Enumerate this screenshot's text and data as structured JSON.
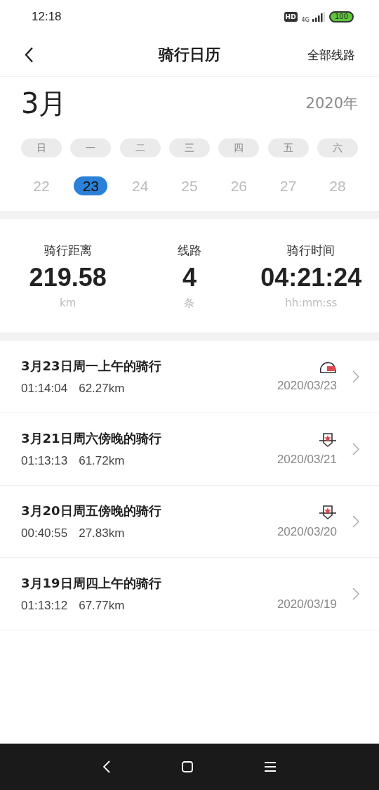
{
  "status_bar": {
    "time": "12:18",
    "hd": "HD",
    "network": "4G",
    "battery": "100"
  },
  "header": {
    "title": "骑行日历",
    "action": "全部线路"
  },
  "calendar": {
    "month": "3月",
    "year": "2020年",
    "weekdays": [
      "日",
      "一",
      "二",
      "三",
      "四",
      "五",
      "六"
    ],
    "days": [
      {
        "label": "22",
        "selected": false
      },
      {
        "label": "23",
        "selected": true
      },
      {
        "label": "24",
        "selected": false
      },
      {
        "label": "25",
        "selected": false
      },
      {
        "label": "26",
        "selected": false
      },
      {
        "label": "27",
        "selected": false
      },
      {
        "label": "28",
        "selected": false
      }
    ]
  },
  "stats": [
    {
      "label": "骑行距离",
      "value": "219.58",
      "unit": "km"
    },
    {
      "label": "线路",
      "value": "4",
      "unit": "条"
    },
    {
      "label": "骑行时间",
      "value": "04:21:24",
      "unit": "hh:mm:ss"
    }
  ],
  "rides": [
    {
      "title": "3月23日周一上午的骑行",
      "duration": "01:14:04",
      "distance": "62.27km",
      "date": "2020/03/23",
      "kind": "helmet"
    },
    {
      "title": "3月21日周六傍晚的骑行",
      "duration": "01:13:13",
      "distance": "61.72km",
      "date": "2020/03/21",
      "kind": "badge"
    },
    {
      "title": "3月20日周五傍晚的骑行",
      "duration": "00:40:55",
      "distance": "27.83km",
      "date": "2020/03/20",
      "kind": "badge"
    },
    {
      "title": "3月19日周四上午的骑行",
      "duration": "01:13:12",
      "distance": "67.77km",
      "date": "2020/03/19",
      "kind": "plain"
    }
  ]
}
